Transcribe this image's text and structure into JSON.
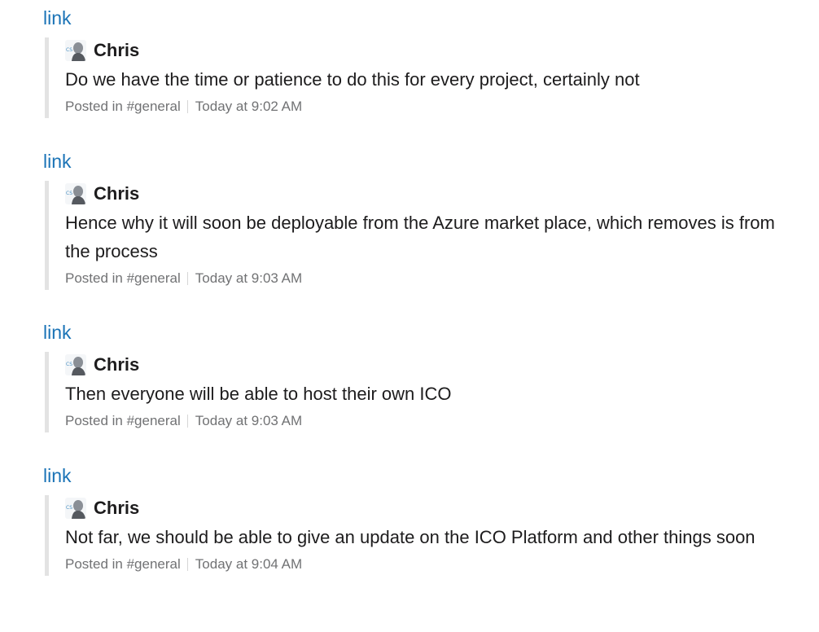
{
  "messages": [
    {
      "link_label": "link",
      "author": "Chris",
      "text": "Do we have the time or patience to do this for every project, certainly not",
      "channel": "Posted in #general",
      "time": "Today at 9:02 AM"
    },
    {
      "link_label": "link",
      "author": "Chris",
      "text": "Hence why it will soon be deployable from the Azure market place, which removes is from the process",
      "channel": "Posted in #general",
      "time": "Today at 9:03 AM"
    },
    {
      "link_label": "link",
      "author": "Chris",
      "text": "Then everyone will be able to host their own ICO",
      "channel": "Posted in #general",
      "time": "Today at 9:03 AM"
    },
    {
      "link_label": "link",
      "author": "Chris",
      "text": "Not far, we should be able to give an update on the ICO Platform and other things soon",
      "channel": "Posted in #general",
      "time": "Today at 9:04 AM"
    }
  ],
  "colors": {
    "link": "#1a73b6",
    "quote_bar": "#e3e3e3",
    "meta_text": "#717274"
  },
  "icons": {
    "avatar": "avatar-icon"
  }
}
